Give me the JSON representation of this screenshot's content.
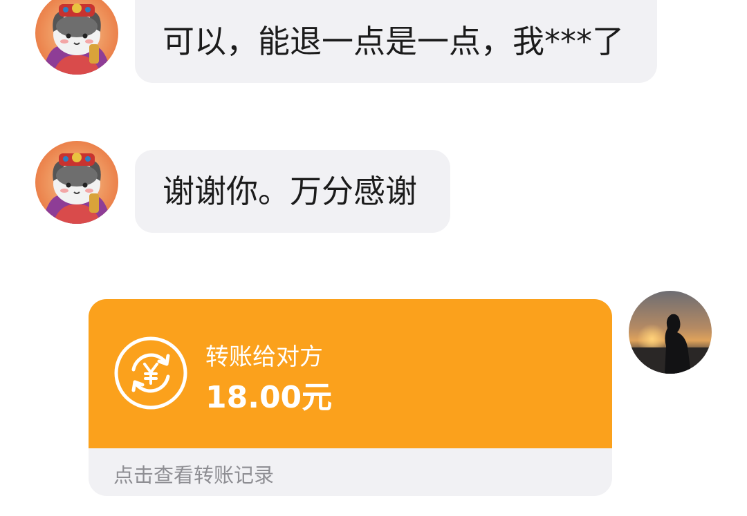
{
  "messages": [
    {
      "sender": "contact",
      "text": "可以，能退一点是一点，我***了"
    },
    {
      "sender": "contact",
      "text": "谢谢你。万分感谢"
    }
  ],
  "transfer": {
    "title": "转账给对方",
    "amount": "18.00元",
    "footer": "点击查看转账记录",
    "color": "#fba11c"
  },
  "icons": {
    "transfer": "yuan-exchange-icon"
  }
}
